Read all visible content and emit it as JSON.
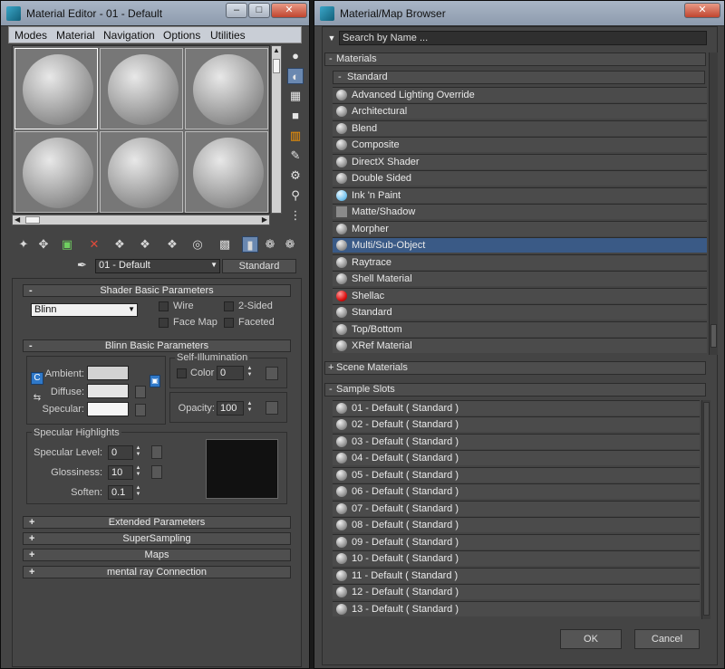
{
  "editor": {
    "title": "Material Editor - 01 - Default",
    "menu": [
      "Modes",
      "Material",
      "Navigation",
      "Options",
      "Utilities"
    ],
    "slot_count": 6,
    "material_name": "01 - Default",
    "material_type": "Standard",
    "shader": {
      "header": "Shader Basic Parameters",
      "shader_value": "Blinn",
      "wire": "Wire",
      "two_sided": "2-Sided",
      "face_map": "Face Map",
      "faceted": "Faceted"
    },
    "blinn": {
      "header": "Blinn Basic Parameters",
      "ambient": "Ambient:",
      "diffuse": "Diffuse:",
      "specular": "Specular:",
      "lock_letter_left": "C",
      "self_illum_title": "Self-Illumination",
      "color_label": "Color",
      "color_value": "0",
      "opacity_label": "Opacity:",
      "opacity_value": "100",
      "spec_title": "Specular Highlights",
      "spec_level_label": "Specular Level:",
      "spec_level_value": "0",
      "gloss_label": "Glossiness:",
      "gloss_value": "10",
      "soften_label": "Soften:",
      "soften_value": "0.1"
    },
    "rollouts": [
      {
        "label": "Extended Parameters"
      },
      {
        "label": "SuperSampling"
      },
      {
        "label": "Maps"
      },
      {
        "label": "mental ray Connection"
      }
    ],
    "colors": {
      "ambient": "#d2d2d2",
      "diffuse": "#e4e4e4",
      "specular": "#f5f5f5",
      "highlight_bg": "#111111"
    },
    "title_buttons": {
      "min": "–",
      "max": "□",
      "close": "✕"
    }
  },
  "browser": {
    "title": "Material/Map Browser",
    "search_placeholder": "Search by Name ...",
    "materials_header": "Materials",
    "standard_header": "Standard",
    "standard_items": [
      {
        "label": "Advanced Lighting Override",
        "icon": "grey-sphere-icon"
      },
      {
        "label": "Architectural",
        "icon": "grey-sphere-icon"
      },
      {
        "label": "Blend",
        "icon": "grey-sphere-icon"
      },
      {
        "label": "Composite",
        "icon": "grey-sphere-icon"
      },
      {
        "label": "DirectX Shader",
        "icon": "grey-sphere-icon"
      },
      {
        "label": "Double Sided",
        "icon": "grey-sphere-icon"
      },
      {
        "label": "Ink 'n Paint",
        "icon": "blue-sphere-icon"
      },
      {
        "label": "Matte/Shadow",
        "icon": "grey-square-icon"
      },
      {
        "label": "Morpher",
        "icon": "grey-sphere-icon"
      },
      {
        "label": "Multi/Sub-Object",
        "icon": "grey-sphere-icon"
      },
      {
        "label": "Raytrace",
        "icon": "grey-sphere-icon"
      },
      {
        "label": "Shell Material",
        "icon": "grey-sphere-icon"
      },
      {
        "label": "Shellac",
        "icon": "red-sphere-icon"
      },
      {
        "label": "Standard",
        "icon": "grey-sphere-icon"
      },
      {
        "label": "Top/Bottom",
        "icon": "grey-sphere-icon"
      },
      {
        "label": "XRef Material",
        "icon": "grey-sphere-icon"
      }
    ],
    "selected_item": "Multi/Sub-Object",
    "scene_materials_header": "Scene Materials",
    "sample_slots_header": "Sample Slots",
    "sample_slots": [
      "01 - Default  ( Standard )",
      "02 - Default  ( Standard )",
      "03 - Default  ( Standard )",
      "04 - Default  ( Standard )",
      "05 - Default  ( Standard )",
      "06 - Default  ( Standard )",
      "07 - Default  ( Standard )",
      "08 - Default  ( Standard )",
      "09 - Default  ( Standard )",
      "10 - Default  ( Standard )",
      "11 - Default  ( Standard )",
      "12 - Default  ( Standard )",
      "13 - Default  ( Standard )"
    ],
    "ok": "OK",
    "cancel": "Cancel",
    "close": "✕",
    "toggle_minus": "-",
    "toggle_plus": "+"
  }
}
